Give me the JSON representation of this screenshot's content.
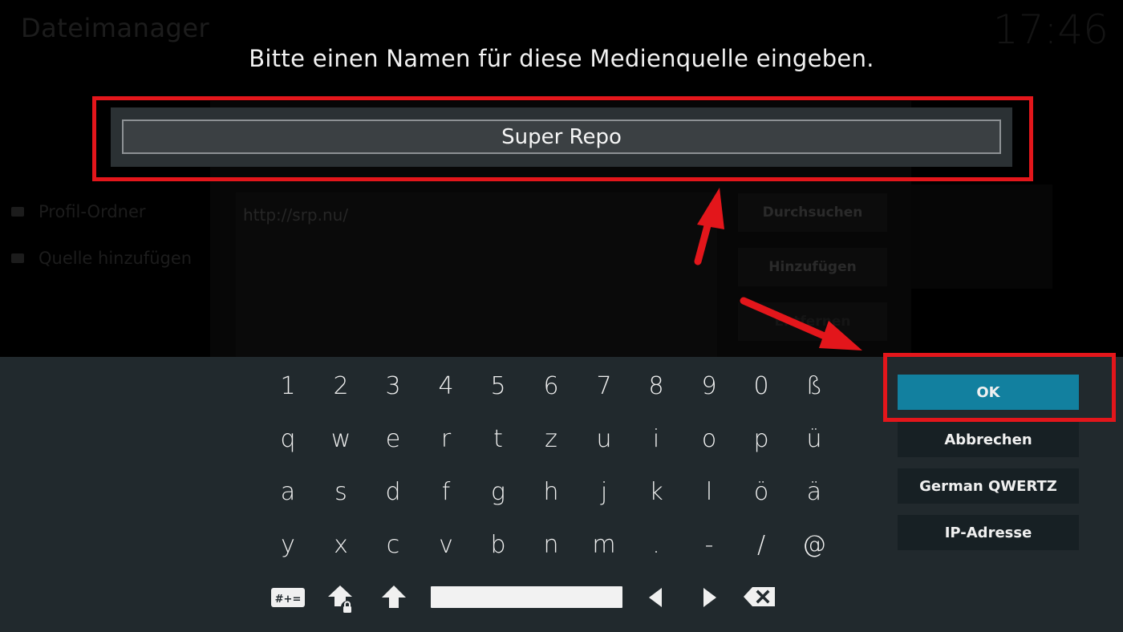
{
  "background": {
    "title": "Dateimanager",
    "clock": "17:46",
    "sidebar_items": [
      "Profil-Ordner",
      "Quelle hinzufügen"
    ],
    "url": "http://srp.nu/",
    "buttons": [
      "Durchsuchen",
      "Hinzufügen",
      "Entfernen"
    ]
  },
  "dialog": {
    "prompt": "Bitte einen Namen für diese Medienquelle eingeben.",
    "input_value": "Super Repo"
  },
  "keyboard": {
    "rows": [
      [
        "1",
        "2",
        "3",
        "4",
        "5",
        "6",
        "7",
        "8",
        "9",
        "0",
        "ß"
      ],
      [
        "q",
        "w",
        "e",
        "r",
        "t",
        "z",
        "u",
        "i",
        "o",
        "p",
        "ü"
      ],
      [
        "a",
        "s",
        "d",
        "f",
        "g",
        "h",
        "j",
        "k",
        "l",
        "ö",
        "ä"
      ],
      [
        "y",
        "x",
        "c",
        "v",
        "b",
        "n",
        "m",
        ".",
        "-",
        "/",
        "@"
      ]
    ],
    "symbols_label": "#+="
  },
  "actions": {
    "ok": "OK",
    "cancel": "Abbrechen",
    "layout": "German QWERTZ",
    "ip": "IP-Adresse"
  },
  "colors": {
    "annotation_red": "#e3161b",
    "ok_blue": "#12809f",
    "keyboard_bg": "#21292d"
  }
}
